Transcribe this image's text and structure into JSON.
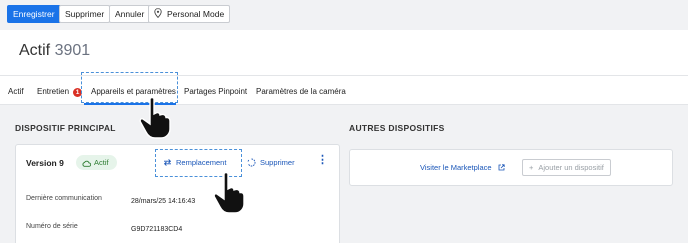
{
  "toolbar": {
    "save_label": "Enregistrer",
    "delete_label": "Supprimer",
    "cancel_label": "Annuler",
    "personal_mode_label": "Personal Mode"
  },
  "header": {
    "title": "Actif",
    "asset_number": "3901"
  },
  "tabs": [
    {
      "label": "Actif"
    },
    {
      "label": "Entretien",
      "badge": "1"
    },
    {
      "label": "Appareils et paramètres",
      "active": true
    },
    {
      "label": "Partages Pinpoint"
    },
    {
      "label": "Paramètres de la caméra"
    }
  ],
  "main_device": {
    "section_title": "DISPOSITIF PRINCIPAL",
    "version": "Version 9",
    "status": "Actif",
    "replace_label": "Remplacement",
    "delete_label": "Supprimer",
    "menu_icon": "more-vert-icon",
    "rows": [
      {
        "label": "Dernière communication",
        "value": "28/mars/25 14:16:43"
      },
      {
        "label": "Numéro de série",
        "value": "G9D721183CD4"
      }
    ]
  },
  "other_devices": {
    "section_title": "AUTRES DISPOSITIFS",
    "marketplace_label": "Visiter le Marketplace",
    "add_label": "Ajouter un dispositif"
  },
  "colors": {
    "primary": "#1a73e8",
    "badge": "#d93025",
    "status_bg": "#e6f4ea",
    "status_text": "#2e7d32",
    "highlight_dash": "#4a90d9"
  }
}
